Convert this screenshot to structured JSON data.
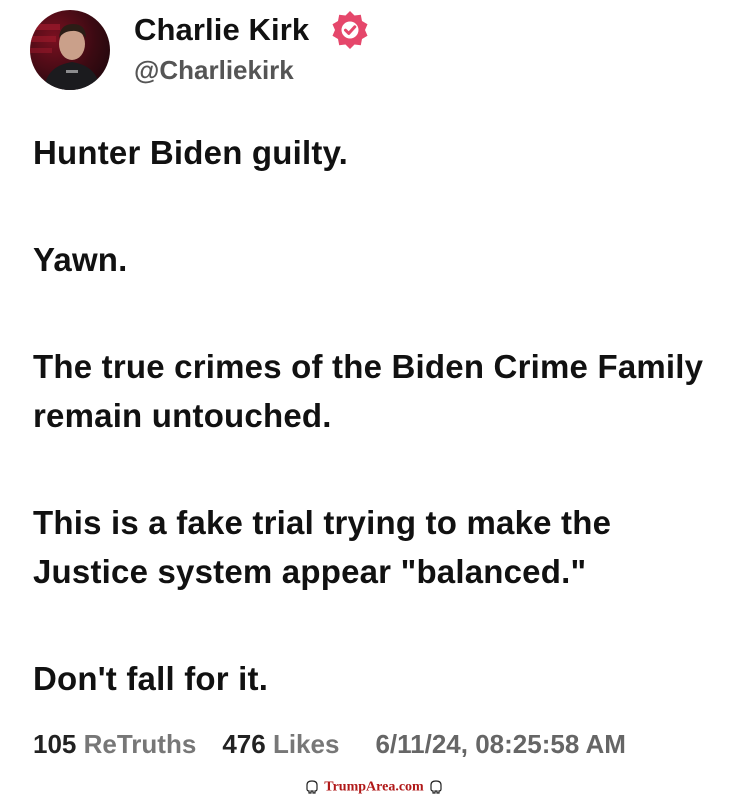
{
  "author": {
    "name": "Charlie Kirk",
    "handle": "@Charliekirk",
    "verified": true,
    "verified_color": "#e5476b"
  },
  "post": {
    "paragraphs": [
      "Hunter Biden guilty.",
      "Yawn.",
      "The true crimes of the Biden Crime Family remain untouched.",
      "This is a fake trial trying to make the Justice system appear \"balanced.\"",
      "Don't fall for it."
    ]
  },
  "stats": {
    "retruths_count": "105",
    "retruths_label": "ReTruths",
    "likes_count": "476",
    "likes_label": "Likes",
    "timestamp": "6/11/24, 08:25:58 AM"
  },
  "watermark": {
    "text": "TrumpArea.com",
    "color": "#b01818",
    "icon": "elephant-icon"
  }
}
